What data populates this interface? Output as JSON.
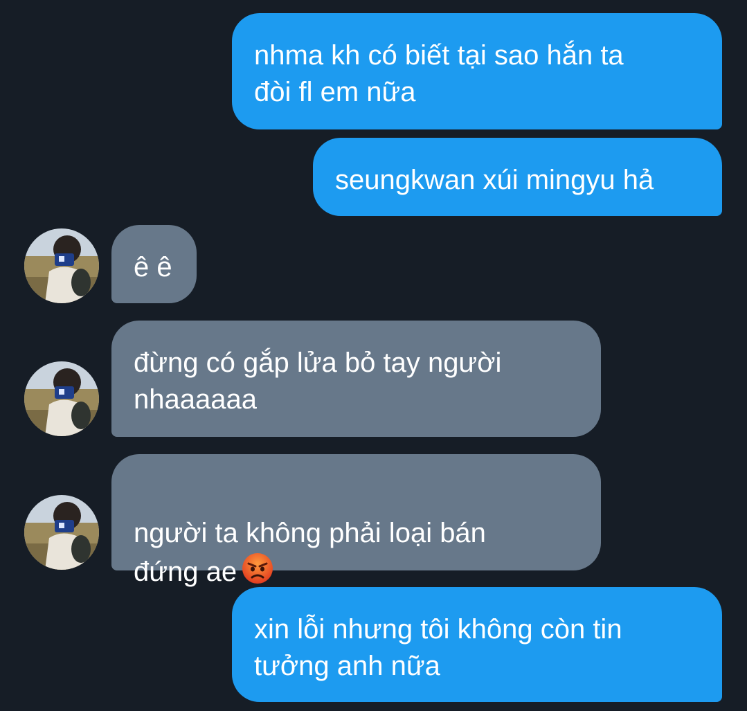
{
  "messages": [
    {
      "direction": "sent",
      "text": "nhma kh có biết tại sao hắn ta\nđòi fl em nữa"
    },
    {
      "direction": "sent",
      "text": "seungkwan xúi mingyu hả"
    },
    {
      "direction": "received",
      "text": "ê ê"
    },
    {
      "direction": "received",
      "text": "đừng có gắp lửa bỏ tay người\nnhaaaaaa"
    },
    {
      "direction": "received",
      "text": "người ta không phải loại bán\nđứng ae",
      "emoji": "angry-face"
    },
    {
      "direction": "sent",
      "text": "xin lỗi nhưng tôi không còn tin\ntưởng anh nữa"
    }
  ],
  "colors": {
    "background": "#161d26",
    "sent_bubble": "#1d9bf0",
    "received_bubble": "#67788a",
    "text": "#ffffff"
  }
}
